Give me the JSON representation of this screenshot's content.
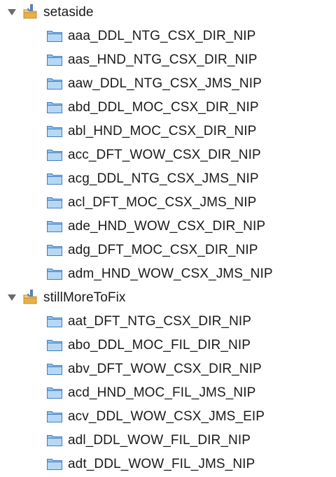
{
  "projects": [
    {
      "name": "setaside",
      "icon": "java-project-folder-icon",
      "expanded": true,
      "folders": [
        "aaa_DDL_NTG_CSX_DIR_NIP",
        "aas_HND_NTG_CSX_DIR_NIP",
        "aaw_DDL_NTG_CSX_JMS_NIP",
        "abd_DDL_MOC_CSX_DIR_NIP",
        "abl_HND_MOC_CSX_DIR_NIP",
        "acc_DFT_WOW_CSX_DIR_NIP",
        "acg_DDL_NTG_CSX_JMS_NIP",
        "acl_DFT_MOC_CSX_JMS_NIP",
        "ade_HND_WOW_CSX_DIR_NIP",
        "adg_DFT_MOC_CSX_DIR_NIP",
        "adm_HND_WOW_CSX_JMS_NIP"
      ]
    },
    {
      "name": "stillMoreToFix",
      "icon": "java-project-folder-icon",
      "expanded": true,
      "folders": [
        "aat_DFT_NTG_CSX_DIR_NIP",
        "abo_DDL_MOC_FIL_DIR_NIP",
        "abv_DFT_WOW_CSX_DIR_NIP",
        "acd_HND_MOC_FIL_JMS_NIP",
        "acv_DDL_WOW_CSX_JMS_EIP",
        "adl_DDL_WOW_FIL_DIR_NIP",
        "adt_DDL_WOW_FIL_JMS_NIP"
      ]
    }
  ],
  "colors": {
    "folder_fill": "#8fc2ea",
    "folder_stroke": "#3f7fc0",
    "project_folder": "#e9b04a",
    "java_badge": "#5a7fb5",
    "triangle": "#6b6b6b"
  }
}
